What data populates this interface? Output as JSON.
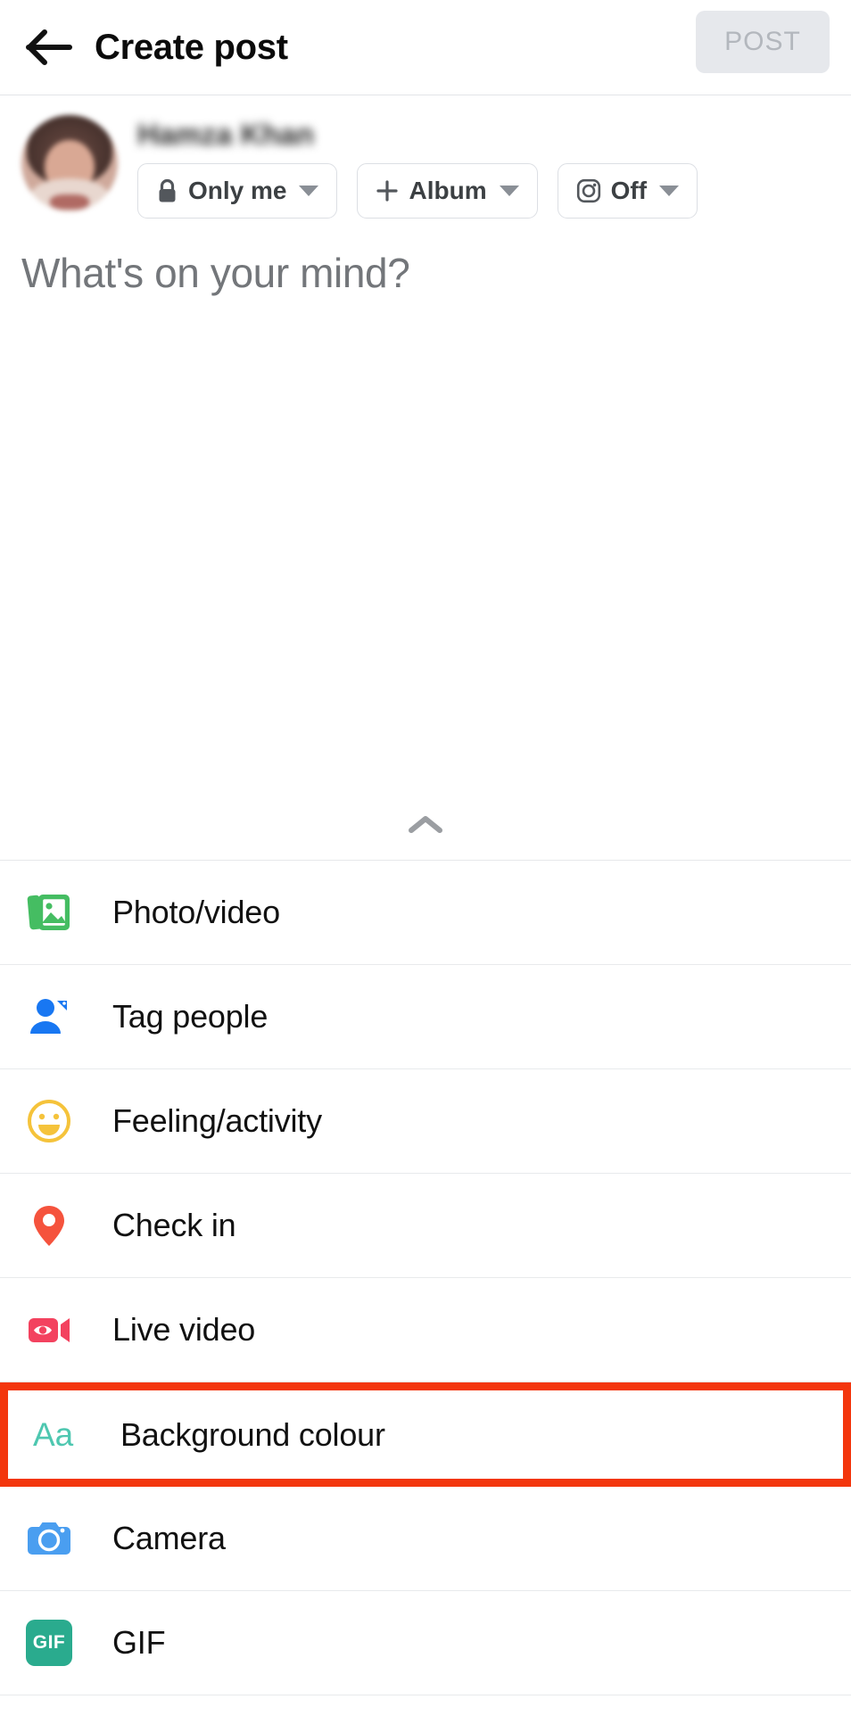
{
  "header": {
    "back_icon": "arrow-left-icon",
    "title": "Create post",
    "post_label": "POST",
    "post_enabled": false,
    "post_bg": "#e6e8ec",
    "post_text_color": "#b3b7bd"
  },
  "composer": {
    "avatar_name": "avatar",
    "user_name": "Hamza Khan",
    "user_name_blurred": true,
    "chips": [
      {
        "icon": "lock-icon",
        "label": "Only me",
        "caret": true
      },
      {
        "icon": "plus-icon",
        "label": "Album",
        "caret": true
      },
      {
        "icon": "instagram-icon",
        "label": "Off",
        "caret": true
      }
    ],
    "placeholder": "What's on your mind?"
  },
  "handle": {
    "icon": "chevron-up-icon"
  },
  "options": [
    {
      "icon": "photo-video-icon",
      "label": "Photo/video",
      "color": "#45bd62",
      "highlighted": false
    },
    {
      "icon": "tag-people-icon",
      "label": "Tag people",
      "color": "#1877f2",
      "highlighted": false
    },
    {
      "icon": "feeling-activity-icon",
      "label": "Feeling/activity",
      "color": "#f5c33b",
      "highlighted": false
    },
    {
      "icon": "check-in-icon",
      "label": "Check in",
      "color": "#f5533d",
      "highlighted": false
    },
    {
      "icon": "live-video-icon",
      "label": "Live video",
      "color": "#f3425f",
      "highlighted": false
    },
    {
      "icon": "background-colour-icon",
      "label": "Background colour",
      "color": "#4ec7b0",
      "highlighted": true
    },
    {
      "icon": "camera-icon",
      "label": "Camera",
      "color": "#4a9ef0",
      "highlighted": false
    },
    {
      "icon": "gif-icon",
      "label": "GIF",
      "color": "#2aab8e",
      "highlighted": false
    }
  ],
  "colors": {
    "highlight": "#f3360d",
    "divider": "#e8eaec",
    "text_primary": "#111111",
    "text_placeholder": "#73767a"
  }
}
